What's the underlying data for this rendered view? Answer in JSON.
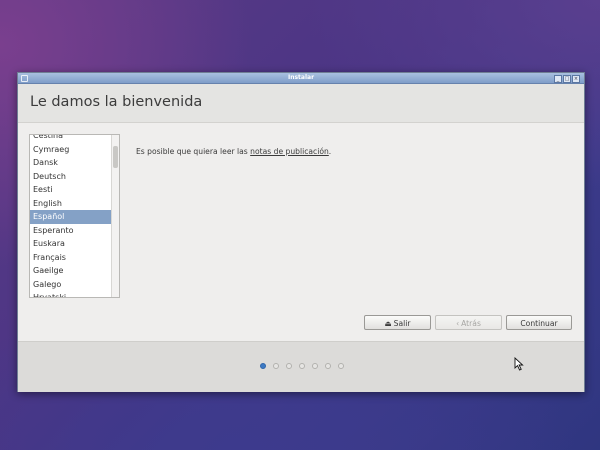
{
  "window": {
    "title": "Instalar",
    "min_label": "_",
    "max_label": "□",
    "close_label": "×"
  },
  "header": {
    "title": "Le damos la bienvenida"
  },
  "languages": [
    "Čeština",
    "Cymraeg",
    "Dansk",
    "Deutsch",
    "Eesti",
    "English",
    "Español",
    "Esperanto",
    "Euskara",
    "Français",
    "Gaeilge",
    "Galego",
    "Hrvatski"
  ],
  "selected_language": "Español",
  "main": {
    "text_before": "Es posible que quiera leer las ",
    "link_text": "notas de publicación",
    "text_after": "."
  },
  "buttons": {
    "quit": "Salir",
    "back": "Atrás",
    "continue": "Continuar"
  },
  "progress": {
    "total_steps": 7,
    "current_step": 1
  },
  "colors": {
    "selection": "#84a1c6",
    "active_dot": "#3d7ac4"
  }
}
